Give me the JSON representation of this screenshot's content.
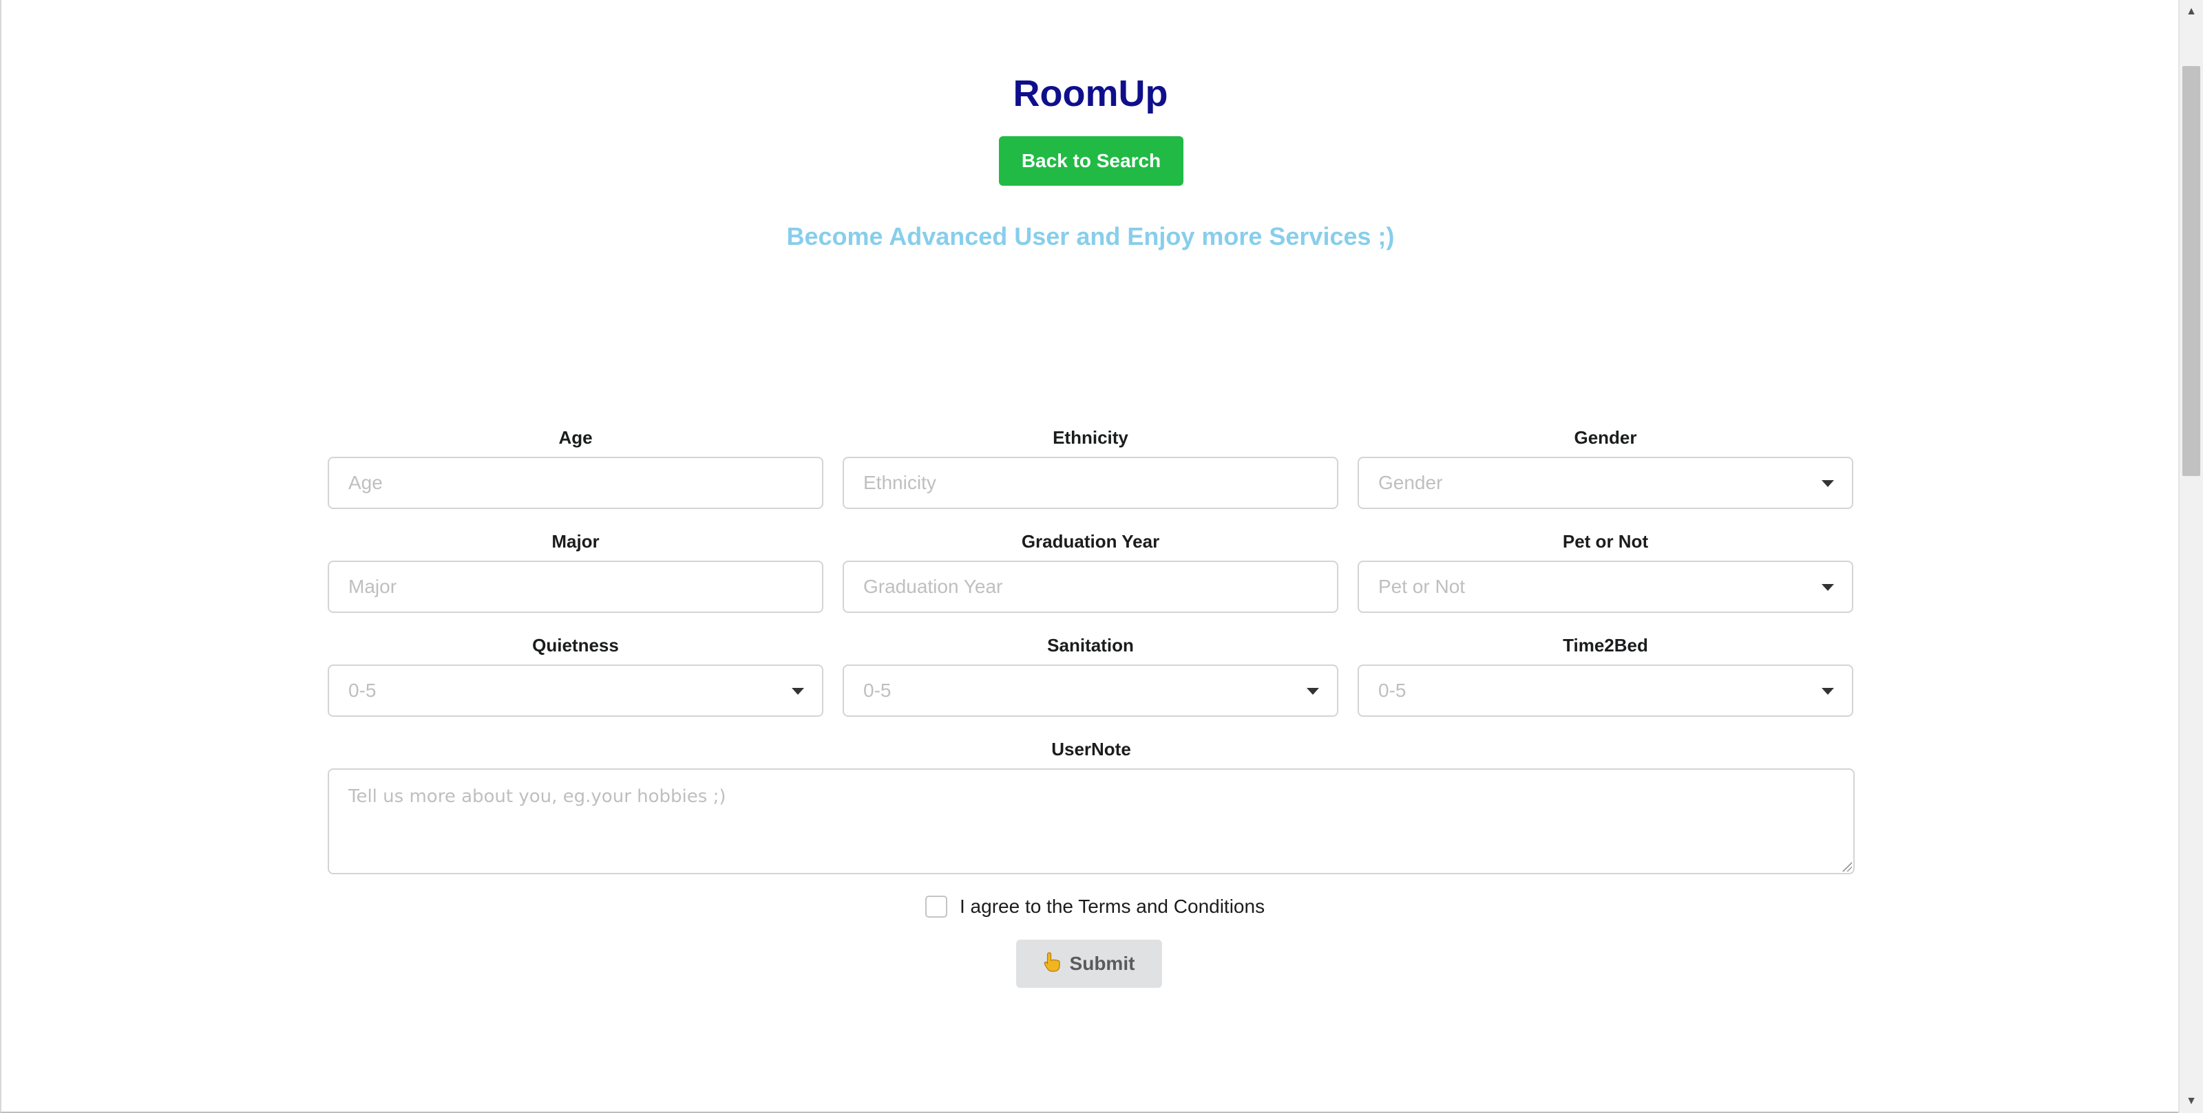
{
  "header": {
    "title": "RoomUp",
    "back_button_label": "Back to Search",
    "subtitle": "Become Advanced User and Enjoy more Services ;)"
  },
  "form": {
    "age": {
      "label": "Age",
      "placeholder": "Age"
    },
    "ethnicity": {
      "label": "Ethnicity",
      "placeholder": "Ethnicity"
    },
    "gender": {
      "label": "Gender",
      "placeholder": "Gender"
    },
    "major": {
      "label": "Major",
      "placeholder": "Major"
    },
    "graduation_year": {
      "label": "Graduation Year",
      "placeholder": "Graduation Year"
    },
    "pet": {
      "label": "Pet or Not",
      "placeholder": "Pet or Not"
    },
    "quietness": {
      "label": "Quietness",
      "placeholder": "0-5"
    },
    "sanitation": {
      "label": "Sanitation",
      "placeholder": "0-5"
    },
    "time2bed": {
      "label": "Time2Bed",
      "placeholder": "0-5"
    },
    "user_note": {
      "label": "UserNote",
      "placeholder": "Tell us more about you, eg.your hobbies ;)"
    },
    "terms_label": "I agree to the Terms and Conditions",
    "submit_label": "Submit",
    "submit_icon": "hand-pointer-icon"
  },
  "colors": {
    "title": "#0f0f8c",
    "back_button": "#21ba45",
    "subtitle": "#87ceeb",
    "submit_button": "#e0e1e2"
  }
}
